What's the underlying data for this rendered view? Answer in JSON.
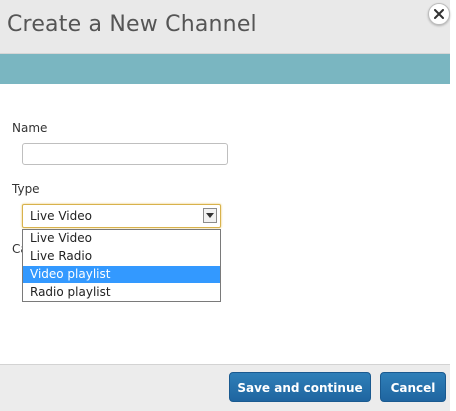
{
  "dialog": {
    "title": "Create a New Channel",
    "close_icon": "close-icon"
  },
  "form": {
    "name_label": "Name",
    "name_value": "",
    "type_label": "Type",
    "type_value": "Live Video",
    "partially_hidden_label": "Ca",
    "type_options": [
      "Live Video",
      "Live Radio",
      "Video playlist",
      "Radio playlist"
    ],
    "highlighted_option": "Video playlist"
  },
  "footer": {
    "save_label": "Save and continue",
    "cancel_label": "Cancel"
  },
  "colors": {
    "accent_band": "#7ab6c1",
    "button_blue": "#2f7fb8",
    "highlight": "#3399ff"
  }
}
